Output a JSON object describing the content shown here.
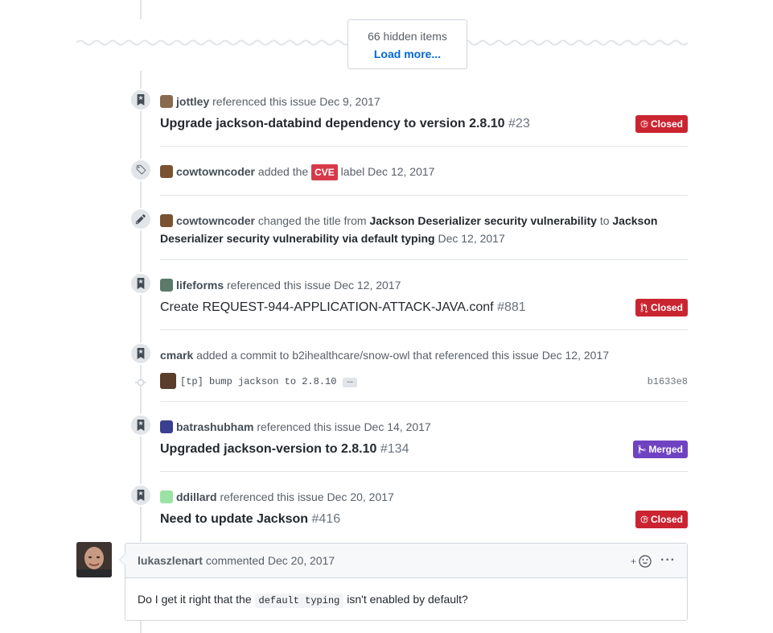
{
  "hidden": {
    "count_text": "66 hidden items",
    "load_more": "Load more..."
  },
  "events": [
    {
      "user": "jottley",
      "action": "referenced this issue",
      "date": "Dec 9, 2017",
      "title": "Upgrade jackson-databind dependency to version 2.8.10",
      "number": "#23",
      "state": "Closed",
      "icon": "bookmark-icon"
    },
    {
      "user": "cowtowncoder",
      "action_before": "added the",
      "label": "CVE",
      "action_after": "label",
      "date": "Dec 12, 2017",
      "icon": "tag-icon"
    },
    {
      "user": "cowtowncoder",
      "action": "changed the title from",
      "old_title": "Jackson Deserializer security vulnerability",
      "to": "to",
      "new_title_a": "Jackson",
      "new_title_b": "Deserializer security vulnerability via default typing",
      "date": "Dec 12, 2017",
      "icon": "pencil-icon"
    },
    {
      "user": "lifeforms",
      "action": "referenced this issue",
      "date": "Dec 12, 2017",
      "title": "Create REQUEST-944-APPLICATION-ATTACK-JAVA.conf",
      "number": "#881",
      "state": "Closed",
      "icon": "bookmark-icon"
    },
    {
      "user": "cmark",
      "action": "added a commit to b2ihealthcare/snow-owl that referenced this issue",
      "date": "Dec 12, 2017",
      "commit_message": "[tp] bump jackson to 2.8.10",
      "ellipsis": "…",
      "sha": "b1633e8",
      "icon": "bookmark-icon"
    },
    {
      "user": "batrashubham",
      "action": "referenced this issue",
      "date": "Dec 14, 2017",
      "title": "Upgraded jackson-version to 2.8.10",
      "number": "#134",
      "state": "Merged",
      "icon": "bookmark-icon"
    },
    {
      "user": "ddillard",
      "action": "referenced this issue",
      "date": "Dec 20, 2017",
      "title": "Need to update Jackson",
      "number": "#416",
      "state": "Closed",
      "icon": "bookmark-icon"
    }
  ],
  "comment": {
    "user": "lukaszlenart",
    "action": "commented",
    "date": "Dec 20, 2017",
    "body_before": "Do I get it right that the",
    "body_code": "default typing",
    "body_after": "isn't enabled by default?",
    "more": "···"
  },
  "colors": {
    "closed": "#cb2431",
    "merged": "#6f42c1",
    "label_cve": "#d73a4a",
    "link": "#0366d6"
  }
}
